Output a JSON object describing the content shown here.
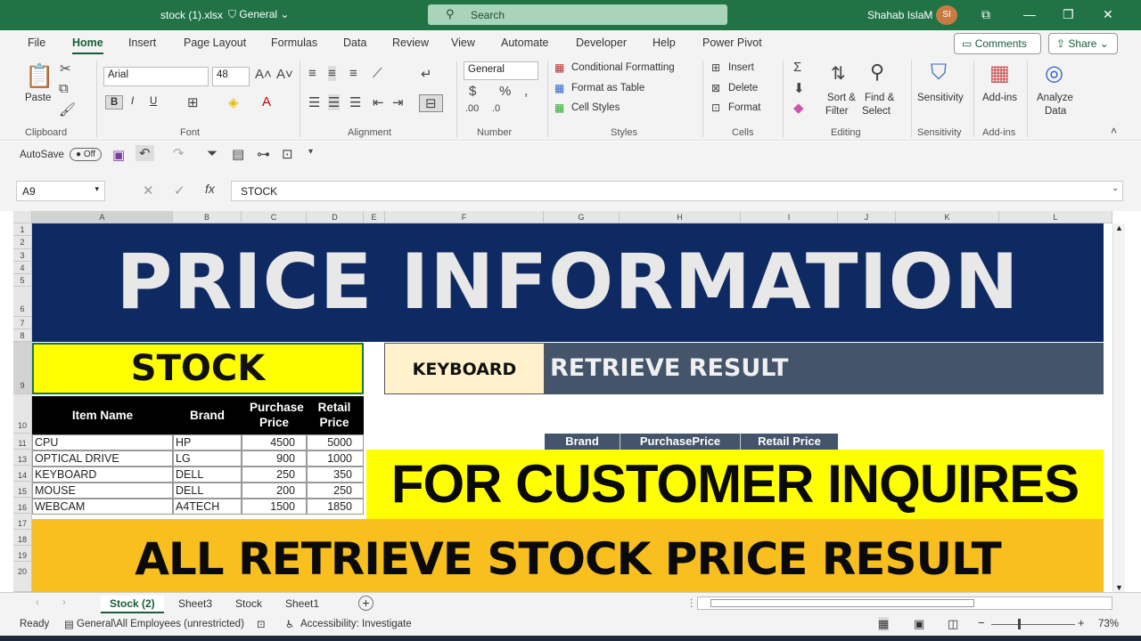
{
  "window": {
    "file_name": "stock (1).xlsx",
    "sensitivity": "General",
    "search_placeholder": "Search",
    "user_name": "Shahab IslaM",
    "user_initials": "SI"
  },
  "ribbon_tabs": [
    "File",
    "Home",
    "Insert",
    "Page Layout",
    "Formulas",
    "Data",
    "Review",
    "View",
    "Automate",
    "Developer",
    "Help",
    "Power Pivot"
  ],
  "top_buttons": {
    "comments": "Comments",
    "share": "Share"
  },
  "ribbon": {
    "clipboard": {
      "paste": "Paste",
      "group": "Clipboard"
    },
    "font": {
      "name": "Arial",
      "size": "48",
      "group": "Font",
      "bold": "B",
      "italic": "I",
      "underline": "U"
    },
    "alignment": {
      "group": "Alignment"
    },
    "number": {
      "format": "General",
      "group": "Number"
    },
    "styles": {
      "conditional": "Conditional Formatting",
      "format_table": "Format as Table",
      "cell_styles": "Cell Styles",
      "group": "Styles"
    },
    "cells": {
      "insert": "Insert",
      "delete": "Delete",
      "format": "Format",
      "group": "Cells"
    },
    "editing": {
      "sort": "Sort &",
      "filter": "Filter",
      "find": "Find &",
      "select": "Select",
      "group": "Editing"
    },
    "sensitivity": {
      "label": "Sensitivity",
      "group": "Sensitivity"
    },
    "addins": {
      "label": "Add-ins",
      "group": "Add-ins"
    },
    "analyze": {
      "line1": "Analyze",
      "line2": "Data"
    }
  },
  "qat": {
    "autosave": "AutoSave",
    "toggle": "Off"
  },
  "formula_bar": {
    "name_box": "A9",
    "formula": "STOCK"
  },
  "columns": [
    "A",
    "B",
    "C",
    "D",
    "E",
    "F",
    "G",
    "H",
    "I",
    "J",
    "K",
    "L"
  ],
  "rows": [
    "1",
    "2",
    "3",
    "4",
    "5",
    "6",
    "7",
    "8",
    "9",
    "10",
    "11",
    "13",
    "14",
    "15",
    "16",
    "17",
    "18",
    "19",
    "20"
  ],
  "sheet": {
    "banner_title": "PRICE INFORMATION",
    "stock_label": "STOCK",
    "lookup_value": "KEYBOARD",
    "retrieve_label": "RETRIEVE RESULT",
    "table_headers": [
      "Item Name",
      "Brand",
      "Purchase Price",
      "Retail Price"
    ],
    "table_rows": [
      [
        "CPU",
        "HP",
        "4500",
        "5000"
      ],
      [
        "OPTICAL DRIVE",
        "LG",
        "900",
        "1000"
      ],
      [
        "KEYBOARD",
        "DELL",
        "250",
        "350"
      ],
      [
        "MOUSE",
        "DELL",
        "200",
        "250"
      ],
      [
        "WEBCAM",
        "A4TECH",
        "1500",
        "1850"
      ]
    ],
    "result_headers": [
      "Brand",
      "PurchasePrice",
      "Retail Price"
    ],
    "overlay_1": "FOR CUSTOMER INQUIRES",
    "overlay_2": "ALL RETRIEVE STOCK PRICE RESULT"
  },
  "sheet_tabs": [
    "Stock (2)",
    "Sheet3",
    "Stock",
    "Sheet1"
  ],
  "status": {
    "ready": "Ready",
    "label": "General\\All Employees (unrestricted)",
    "accessibility": "Accessibility: Investigate",
    "zoom": "73%"
  },
  "colors": {
    "excel_green": "#217346",
    "banner_navy": "#0f2a63",
    "stock_yellow": "#ffff00",
    "result_slate": "#44546a",
    "overlay_gold": "#f9bf1f"
  }
}
